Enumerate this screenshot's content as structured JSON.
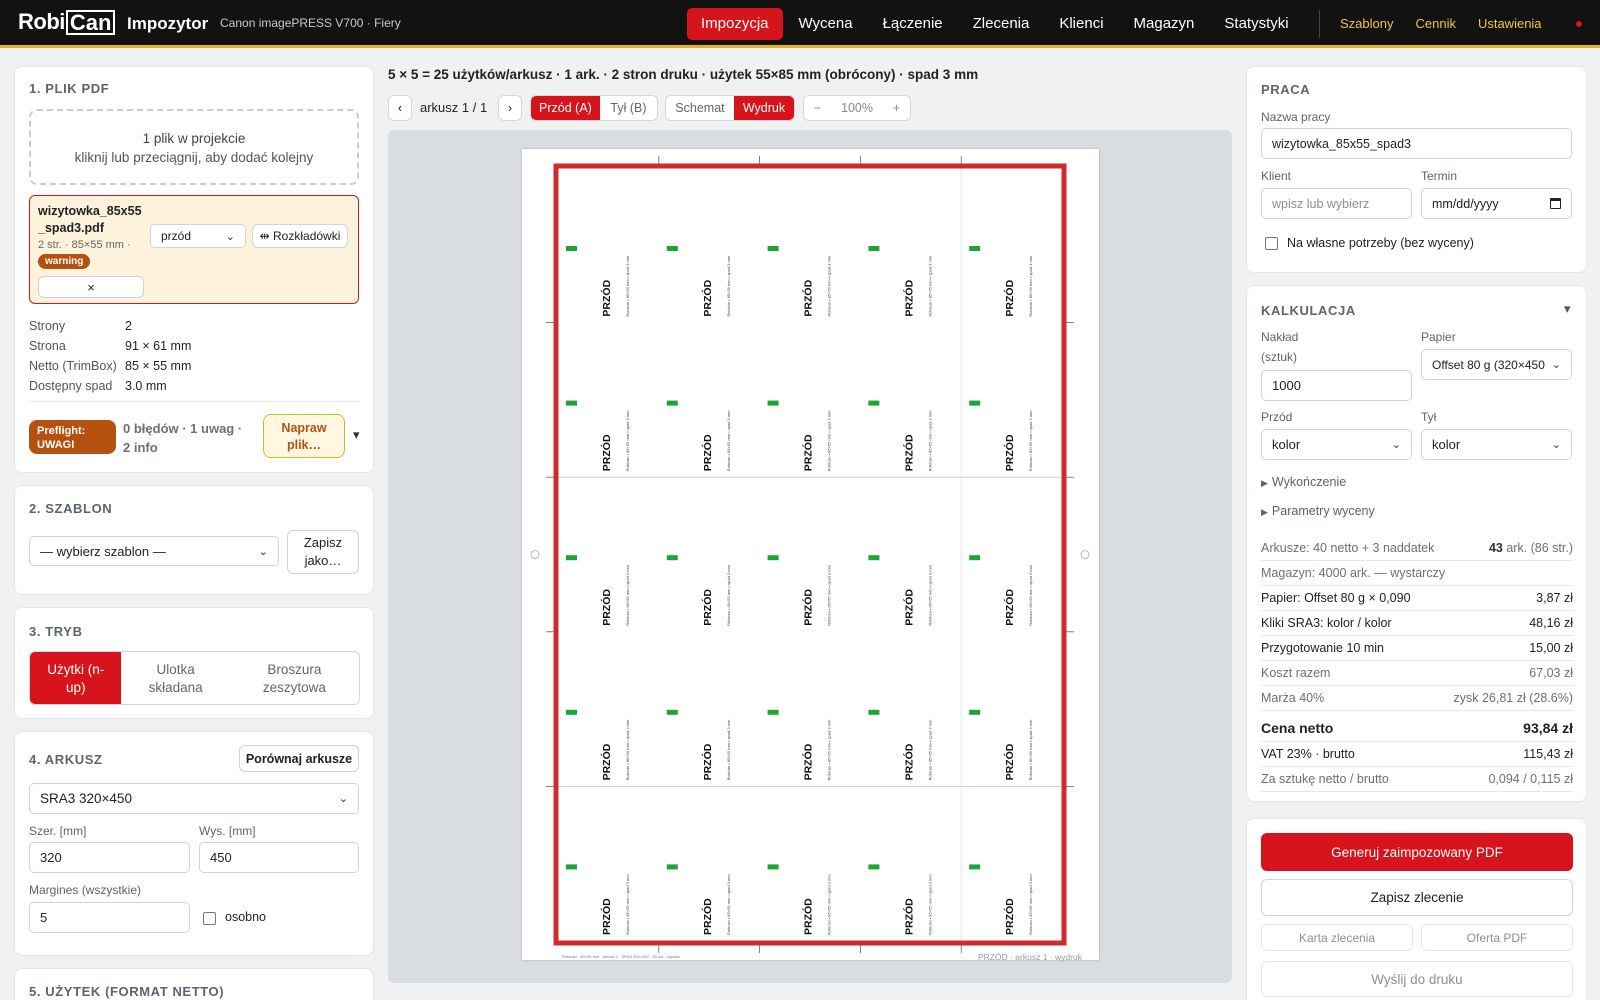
{
  "header": {
    "logo_robi": "Robi",
    "logo_can": "Can",
    "app_name": "Impozytor",
    "device": "Canon imagePRESS V700 · Fiery",
    "nav": [
      "Impozycja",
      "Wycena",
      "Łączenie",
      "Zlecenia",
      "Klienci",
      "Magazyn",
      "Statystyki"
    ],
    "nav_active": "Impozycja",
    "right_nav": [
      "Szablony",
      "Cennik",
      "Ustawienia"
    ],
    "accent": "#d7131b",
    "gold": "#e3b21d"
  },
  "left": {
    "pdf": {
      "title": "1. PLIK PDF",
      "drop_line1": "1 plik w projekcie",
      "drop_line2": "kliknij lub przeciągnij, aby dodać kolejny",
      "file_name_1": "wizytowka_85x55",
      "file_name_2": "_spad3.pdf",
      "file_meta": "2 str. · 85×55 mm ·",
      "badge": "warning",
      "side_select": "przód",
      "spread_button": "⇹ Rozkładówki",
      "remove_button": "×",
      "props": [
        {
          "k": "Strony",
          "v": "2"
        },
        {
          "k": "Strona",
          "v": "91 × 61 mm"
        },
        {
          "k": "Netto (TrimBox)",
          "v": "85 × 55 mm"
        },
        {
          "k": "Dostępny spad",
          "v": "3.0 mm"
        }
      ],
      "preflight_badge_1": "Preflight:",
      "preflight_badge_2": "UWAGI",
      "preflight_text_1": "0 błędów · 1 uwag ·",
      "preflight_text_2": "2 info",
      "fix_button_1": "Napraw",
      "fix_button_2": "plik…",
      "expand": "▾"
    },
    "template": {
      "title": "2. SZABLON",
      "select": "— wybierz szablon —",
      "save_1": "Zapisz",
      "save_2": "jako…"
    },
    "mode": {
      "title": "3. TRYB",
      "options": [
        {
          "l1": "Użytki (n-",
          "l2": "up)"
        },
        {
          "l1": "Ulotka",
          "l2": "składana"
        },
        {
          "l1": "Broszura",
          "l2": "zeszytowa"
        }
      ]
    },
    "sheet": {
      "title": "4. ARKUSZ",
      "compare": "Porównaj arkusze",
      "format": "SRA3 320×450",
      "width_label": "Szer. [mm]",
      "width": "320",
      "height_label": "Wys. [mm]",
      "height": "450",
      "margin_label": "Margines (wszystkie)",
      "margin": "5",
      "separate": "osobno"
    },
    "next_section": "5. UŻYTEK (FORMAT NETTO)"
  },
  "center": {
    "summary": "5 × 5 = 25 użytków/arkusz · 1 ark. · 2 stron druku · użytek 55×85 mm (obrócony) · spad 3 mm",
    "prev": "‹",
    "next": "›",
    "sheet_label": "arkusz 1 / 1",
    "front": "Przód (A)",
    "back": "Tył (B)",
    "schema": "Schemat",
    "print": "Wydruk",
    "zoom_minus": "−",
    "zoom": "100%",
    "zoom_plus": "+",
    "card_front_label": "PRZÓD",
    "card_small_text": "Robican • 85×55 mm • spad 3 mm",
    "footer_left": "Robican · 85×55 mm · arkusz 1 · SRA3 320×450 · 25 szt. · wydruk",
    "footer_right": "PRZÓD · arkusz 1 · wydruk"
  },
  "right": {
    "job": {
      "title": "PRACA",
      "name_label": "Nazwa pracy",
      "name": "wizytowka_85x55_spad3",
      "client_label": "Klient",
      "client_placeholder": "wpisz lub wybierz",
      "deadline_label": "Termin",
      "deadline_placeholder": "mm/dd/yyyy",
      "own_use": "Na własne potrzeby (bez wyceny)"
    },
    "calc": {
      "title": "KALKULACJA",
      "toggle": "▾",
      "qty_label_1": "Nakład",
      "qty_label_2": "(sztuk)",
      "qty": "1000",
      "paper_label": "Papier",
      "paper": "Offset 80 g (320×450",
      "front_label": "Przód",
      "front": "kolor",
      "back_label": "Tył",
      "back": "kolor",
      "finishing": "Wykończenie",
      "pricing_params": "Parametry wyceny",
      "rows": [
        {
          "k": "Arkusze: 40 netto + 3 naddatek",
          "v_bold": "43",
          "v": " ark. (86 str.)",
          "style": "muted"
        },
        {
          "k": "Magazyn: 4000 ark. — wystarczy",
          "v_bold": "",
          "v": "",
          "style": "muted"
        },
        {
          "k": "Papier: Offset 80 g × 0,090",
          "v_bold": "",
          "v": "3,87 zł",
          "style": ""
        },
        {
          "k": "Kliki SRA3: kolor / kolor",
          "v_bold": "",
          "v": "48,16 zł",
          "style": ""
        },
        {
          "k": "Przygotowanie 10 min",
          "v_bold": "",
          "v": "15,00 zł",
          "style": ""
        },
        {
          "k": "Koszt razem",
          "v_bold": "",
          "v": "67,03 zł",
          "style": "muted"
        },
        {
          "k": "Marża 40%",
          "v_bold": "",
          "v": "zysk 26,81 zł (28.6%)",
          "style": "muted"
        },
        {
          "k": "Cena netto",
          "v_bold": "",
          "v": "93,84 zł",
          "style": "big"
        },
        {
          "k": "VAT 23% · brutto",
          "v_bold": "",
          "v": "115,43 zł",
          "style": ""
        },
        {
          "k": "Za sztukę netto / brutto",
          "v_bold": "",
          "v": "0,094 / 0,115 zł",
          "style": "muted"
        }
      ]
    },
    "actions": {
      "generate": "Generuj zaimpozowany PDF",
      "save_order": "Zapisz zlecenie",
      "order_card": "Karta zlecenia",
      "offer_pdf": "Oferta PDF",
      "send_print": "Wyślij do druku"
    }
  }
}
